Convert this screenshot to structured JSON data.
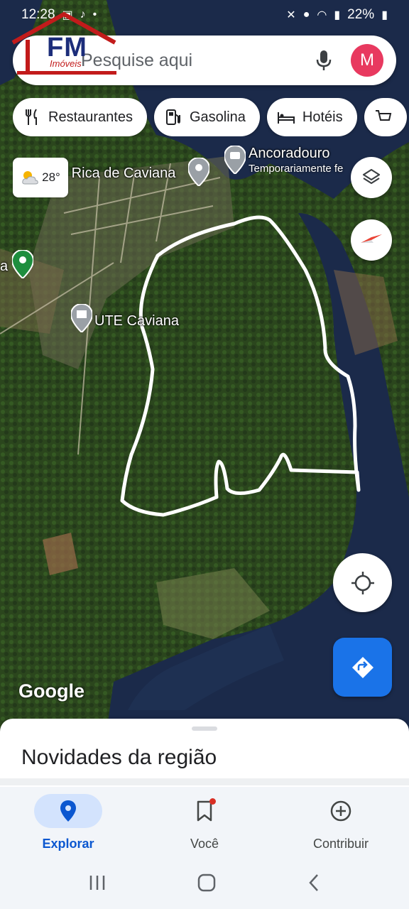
{
  "status_bar": {
    "time": "12:28",
    "battery": "22%"
  },
  "watermark": {
    "brand": "FM",
    "sub": "Imóveis"
  },
  "search": {
    "placeholder": "Pesquise aqui",
    "avatar_letter": "M"
  },
  "chips": [
    {
      "label": "Restaurantes",
      "icon": "fork-knife-icon"
    },
    {
      "label": "Gasolina",
      "icon": "gas-station-icon"
    },
    {
      "label": "Hotéis",
      "icon": "bed-icon"
    }
  ],
  "weather": {
    "temp": "28°",
    "icon": "partly-cloudy-icon"
  },
  "map_labels": {
    "town": "a Rica de Caviana",
    "poi1_name": "Ancoradouro",
    "poi1_status": "Temporariamente fe",
    "poi2_name": "UTE Caviana",
    "left_edge": "a"
  },
  "google_logo": "Google",
  "sheet": {
    "title": "Novidades da região"
  },
  "nav": [
    {
      "label": "Explorar",
      "active": true
    },
    {
      "label": "Você",
      "active": false
    },
    {
      "label": "Contribuir",
      "active": false
    }
  ],
  "colors": {
    "accent": "#1a73e8",
    "avatar_bg": "#e8395f",
    "nav_active": "#0b57d0",
    "water": "#1b2a4a",
    "forest": "#2d4a1f"
  }
}
